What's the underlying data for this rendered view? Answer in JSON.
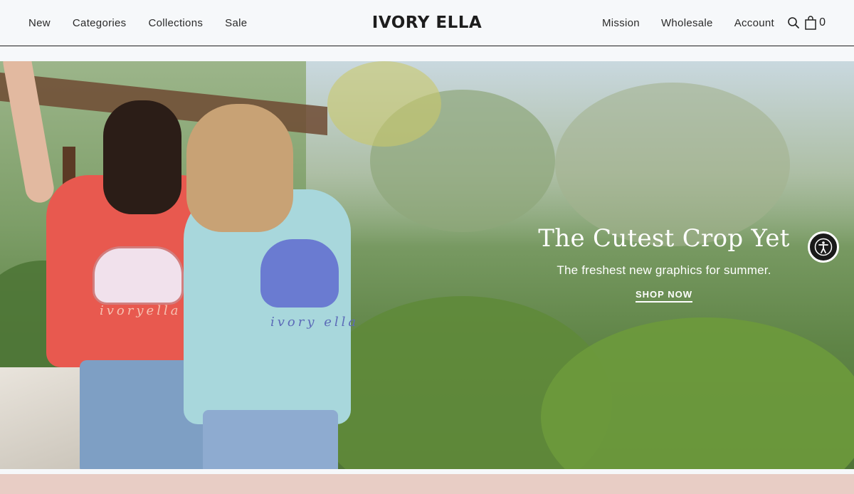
{
  "header": {
    "logo": "IVORY ELLA",
    "nav_left": [
      {
        "label": "New"
      },
      {
        "label": "Categories"
      },
      {
        "label": "Collections"
      },
      {
        "label": "Sale"
      }
    ],
    "nav_right": [
      {
        "label": "Mission"
      },
      {
        "label": "Wholesale"
      },
      {
        "label": "Account"
      }
    ],
    "icons": {
      "search": "search-icon",
      "cart": "shopping-bag-icon"
    },
    "cart_count": "0"
  },
  "hero": {
    "title": "The Cutest Crop Yet",
    "subtitle": "The freshest new graphics for summer.",
    "cta": "SHOP NOW",
    "shirt_brand_left": "ivoryella",
    "shirt_brand_right": "ivory ella"
  },
  "accessibility": {
    "icon": "accessibility-icon"
  },
  "colors": {
    "header_bg": "#f6f8fa",
    "promo_bar": "#e8cdc5",
    "hero_text": "#ffffff",
    "shirt_coral": "#e8594f",
    "shirt_mint": "#a8d7dc"
  }
}
